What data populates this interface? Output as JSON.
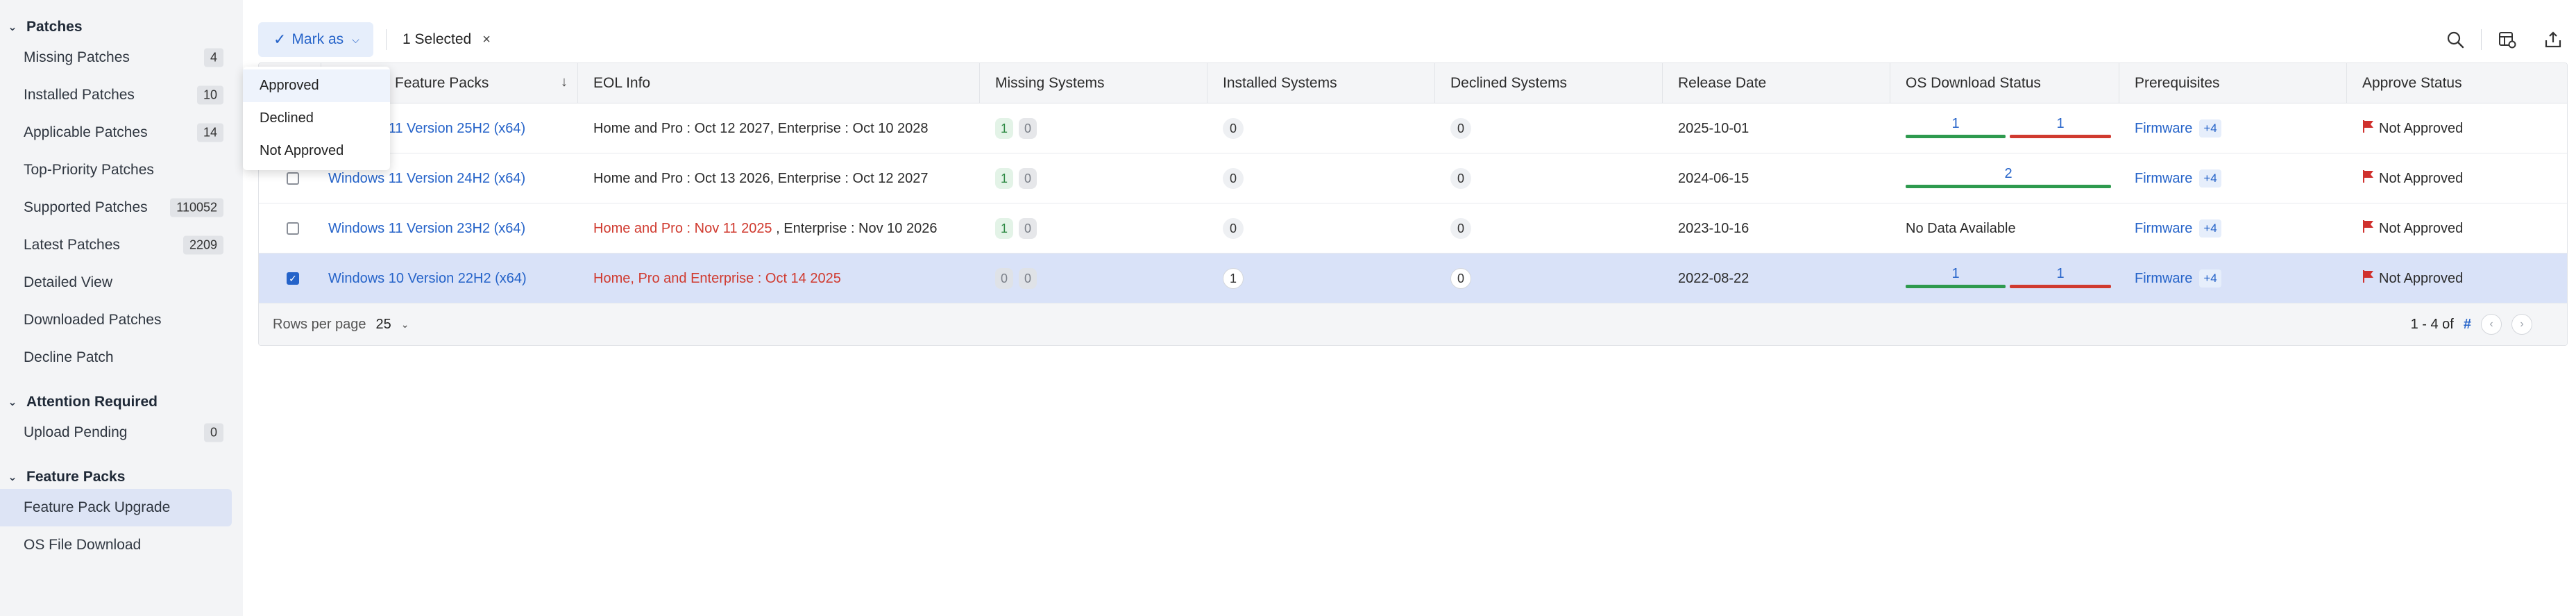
{
  "sidebar": {
    "sections": [
      {
        "title": "Patches",
        "items": [
          {
            "label": "Missing Patches",
            "count": "4"
          },
          {
            "label": "Installed Patches",
            "count": "10"
          },
          {
            "label": "Applicable Patches",
            "count": "14"
          },
          {
            "label": "Top-Priority Patches",
            "count": ""
          },
          {
            "label": "Supported Patches",
            "count": "110052"
          },
          {
            "label": "Latest Patches",
            "count": "2209"
          },
          {
            "label": "Detailed View",
            "count": ""
          },
          {
            "label": "Downloaded Patches",
            "count": ""
          },
          {
            "label": "Decline Patch",
            "count": ""
          }
        ]
      },
      {
        "title": "Attention Required",
        "items": [
          {
            "label": "Upload Pending",
            "count": "0"
          }
        ]
      },
      {
        "title": "Feature Packs",
        "items": [
          {
            "label": "Feature Pack Upgrade",
            "count": "",
            "active": true
          },
          {
            "label": "OS File Download",
            "count": ""
          }
        ]
      }
    ]
  },
  "toolbar": {
    "mark_as": "Mark as",
    "selected": "1 Selected"
  },
  "dropdown": {
    "items": [
      "Approved",
      "Declined",
      "Not Approved"
    ]
  },
  "table": {
    "headers": {
      "feature_packs": "Feature Packs",
      "eol": "EOL Info",
      "missing": "Missing Systems",
      "installed": "Installed Systems",
      "declined": "Declined Systems",
      "release": "Release Date",
      "os": "OS Download Status",
      "prereq": "Prerequisites",
      "approve": "Approve Status"
    },
    "rows": [
      {
        "name": "Windows 11 Version 25H2 (x64)",
        "eol": "Home and Pro : Oct 12 2027, Enterprise : Oct 10 2028",
        "missing": [
          "1",
          "0"
        ],
        "installed": "0",
        "declined": "0",
        "release": "2025-10-01",
        "os": [
          "1",
          "1"
        ],
        "prereq": "Firmware",
        "prereq_more": "+4",
        "approve": "Not Approved"
      },
      {
        "name": "Windows 11 Version 24H2 (x64)",
        "eol": "Home and Pro : Oct 13 2026, Enterprise : Oct 12 2027",
        "missing": [
          "1",
          "0"
        ],
        "installed": "0",
        "declined": "0",
        "release": "2024-06-15",
        "os": [
          "2"
        ],
        "prereq": "Firmware",
        "prereq_more": "+4",
        "approve": "Not Approved"
      },
      {
        "name": "Windows 11 Version 23H2 (x64)",
        "eol_red": "Home and Pro : Nov 11 2025",
        "eol_rest": " , Enterprise : Nov 10 2026",
        "missing": [
          "1",
          "0"
        ],
        "installed": "0",
        "declined": "0",
        "release": "2023-10-16",
        "os_text": "No Data Available",
        "prereq": "Firmware",
        "prereq_more": "+4",
        "approve": "Not Approved"
      },
      {
        "name": "Windows 10 Version 22H2 (x64)",
        "eol_red": "Home, Pro and Enterprise : Oct 14 2025",
        "missing": [
          "0",
          "0"
        ],
        "installed": "1",
        "declined": "0",
        "release": "2022-08-22",
        "os": [
          "1",
          "1"
        ],
        "prereq": "Firmware",
        "prereq_more": "+4",
        "approve": "Not Approved",
        "selected": true
      }
    ]
  },
  "footer": {
    "rows_per_page_label": "Rows per page",
    "rows_per_page": "25",
    "range": "1 - 4 of",
    "total": "#"
  },
  "colors": {
    "accent": "#2563c9",
    "success_bar": "#2e9a4e",
    "fail_bar": "#d03a2f",
    "selected_row": "#d9e2f8",
    "flag": "#d0312d"
  },
  "icons": [
    "search-icon",
    "column-settings-icon",
    "export-icon",
    "flag-icon",
    "check-icon",
    "chevron-down-icon",
    "sort-down-icon"
  ]
}
